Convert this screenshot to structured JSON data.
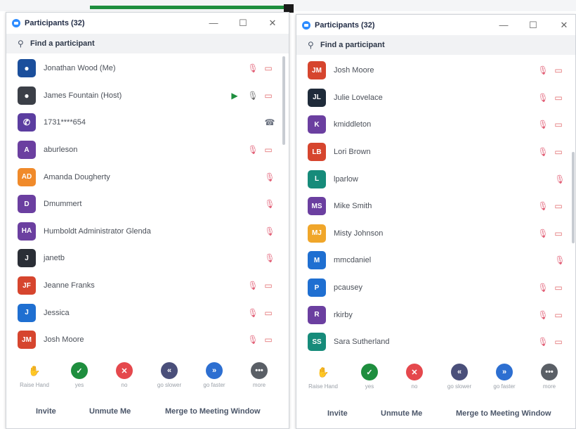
{
  "colors": {
    "zoom_blue": "#2d8cff",
    "muted_red": "#e0676a",
    "green": "#1e8e3e"
  },
  "left_window": {
    "title": "Participants (32)",
    "search_placeholder": "Find a participant",
    "participants": [
      {
        "initials": "",
        "name": "Jonathan Wood (Me)",
        "color": "#1b4f9c",
        "icons": [
          "mic-off",
          "video-off"
        ]
      },
      {
        "initials": "",
        "name": "James Fountain (Host)",
        "color": "#3b3f47",
        "icons": [
          "share-screen",
          "mic-on",
          "video-off"
        ]
      },
      {
        "initials": "",
        "name": "1731****654",
        "color": "#5b3da0",
        "icons": [
          "phone"
        ]
      },
      {
        "initials": "A",
        "name": "aburleson",
        "color": "#6b3fa0",
        "icons": [
          "mic-off",
          "video-off"
        ]
      },
      {
        "initials": "AD",
        "name": "Amanda Dougherty",
        "color": "#f08a2a",
        "icons": [
          "mic-off"
        ]
      },
      {
        "initials": "D",
        "name": "Dmummert",
        "color": "#6b3fa0",
        "icons": [
          "mic-off"
        ]
      },
      {
        "initials": "HA",
        "name": "Humboldt Administrator Glenda",
        "color": "#6b3fa0",
        "icons": [
          "mic-off"
        ]
      },
      {
        "initials": "J",
        "name": "janetb",
        "color": "#2a2e36",
        "icons": [
          "mic-off"
        ]
      },
      {
        "initials": "JF",
        "name": "Jeanne Franks",
        "color": "#d6452e",
        "icons": [
          "mic-off",
          "video-off"
        ]
      },
      {
        "initials": "J",
        "name": "Jessica",
        "color": "#1f6fd1",
        "icons": [
          "mic-off",
          "video-off"
        ]
      },
      {
        "initials": "JM",
        "name": "Josh Moore",
        "color": "#d6452e",
        "icons": [
          "mic-off",
          "video-off"
        ]
      }
    ],
    "reactions": [
      {
        "label": "Raise Hand",
        "glyph": "✋",
        "color": "#ffffff"
      },
      {
        "label": "yes",
        "glyph": "✓",
        "color": "#1e8e3e"
      },
      {
        "label": "no",
        "glyph": "✕",
        "color": "#e5484d"
      },
      {
        "label": "go slower",
        "glyph": "«",
        "color": "#4a4f7a"
      },
      {
        "label": "go faster",
        "glyph": "»",
        "color": "#2d6fd1"
      },
      {
        "label": "more",
        "glyph": "•••",
        "color": "#5a5f66"
      }
    ],
    "footer": {
      "invite": "Invite",
      "unmute": "Unmute Me",
      "merge": "Merge to Meeting Window"
    }
  },
  "right_window": {
    "title": "Participants (32)",
    "search_placeholder": "Find a participant",
    "participants": [
      {
        "initials": "JM",
        "name": "Josh Moore",
        "color": "#d6452e",
        "icons": [
          "mic-off",
          "video-off"
        ]
      },
      {
        "initials": "JL",
        "name": "Julie Lovelace",
        "color": "#1f2b3a",
        "icons": [
          "mic-off",
          "video-off"
        ]
      },
      {
        "initials": "K",
        "name": "kmiddleton",
        "color": "#6b3fa0",
        "icons": [
          "mic-off",
          "video-off"
        ]
      },
      {
        "initials": "LB",
        "name": "Lori Brown",
        "color": "#d6452e",
        "icons": [
          "mic-off",
          "video-off"
        ]
      },
      {
        "initials": "L",
        "name": "lparlow",
        "color": "#168b7a",
        "icons": [
          "mic-off"
        ]
      },
      {
        "initials": "MS",
        "name": "Mike Smith",
        "color": "#6b3fa0",
        "icons": [
          "mic-off",
          "video-off"
        ]
      },
      {
        "initials": "MJ",
        "name": "Misty Johnson",
        "color": "#f0a62a",
        "icons": [
          "mic-off",
          "video-off"
        ]
      },
      {
        "initials": "M",
        "name": "mmcdaniel",
        "color": "#1f6fd1",
        "icons": [
          "mic-off"
        ]
      },
      {
        "initials": "P",
        "name": "pcausey",
        "color": "#1f6fd1",
        "icons": [
          "mic-off",
          "video-off"
        ]
      },
      {
        "initials": "R",
        "name": "rkirby",
        "color": "#6b3fa0",
        "icons": [
          "mic-off",
          "video-off"
        ]
      },
      {
        "initials": "SS",
        "name": "Sara Sutherland",
        "color": "#168b7a",
        "icons": [
          "mic-off",
          "video-off"
        ]
      }
    ],
    "reactions": [
      {
        "label": "Raise Hand",
        "glyph": "✋",
        "color": "#ffffff"
      },
      {
        "label": "yes",
        "glyph": "✓",
        "color": "#1e8e3e"
      },
      {
        "label": "no",
        "glyph": "✕",
        "color": "#e5484d"
      },
      {
        "label": "go slower",
        "glyph": "«",
        "color": "#4a4f7a"
      },
      {
        "label": "go faster",
        "glyph": "»",
        "color": "#2d6fd1"
      },
      {
        "label": "more",
        "glyph": "•••",
        "color": "#5a5f66"
      }
    ],
    "footer": {
      "invite": "Invite",
      "unmute": "Unmute Me",
      "merge": "Merge to Meeting Window"
    }
  }
}
